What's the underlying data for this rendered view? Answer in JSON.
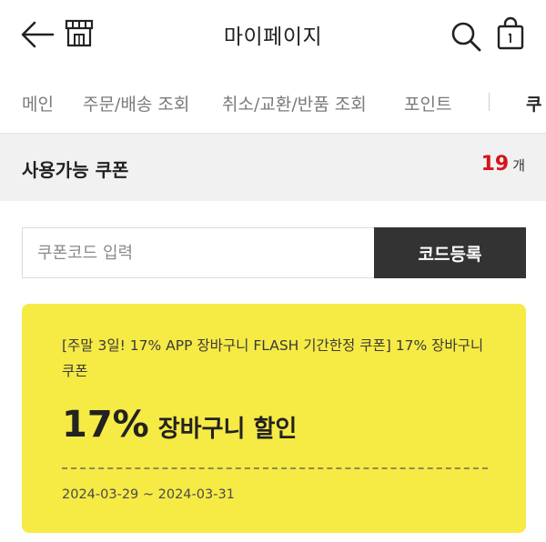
{
  "header": {
    "title": "마이페이지"
  },
  "tabs": [
    {
      "label": "메인"
    },
    {
      "label": "주문/배송 조회"
    },
    {
      "label": "취소/교환/반품 조회"
    },
    {
      "label": "포인트"
    },
    {
      "label": "쿠"
    }
  ],
  "coupon_summary": {
    "label": "사용가능 쿠폰",
    "count": "19",
    "unit": "개"
  },
  "code_form": {
    "placeholder": "쿠폰코드 입력",
    "value": "",
    "button_label": "코드등록"
  },
  "coupons": [
    {
      "description": "[주말 3일! 17% APP 장바구니 FLASH 기간한정 쿠폰] 17% 장바구니 쿠폰",
      "discount_percent": "17%",
      "discount_text": "장바구니 할인",
      "period": "2024-03-29 ~ 2024-03-31",
      "color": "#f6ea45"
    }
  ],
  "colors": {
    "accent_count": "#d8131b",
    "button_bg": "#333333",
    "coupon_bg": "#f6ea45",
    "summary_bg": "#f1f1f1"
  },
  "icons": {
    "back": "arrow-left-icon",
    "store": "store-icon",
    "search": "search-icon",
    "bag": "shopping-bag-icon"
  }
}
